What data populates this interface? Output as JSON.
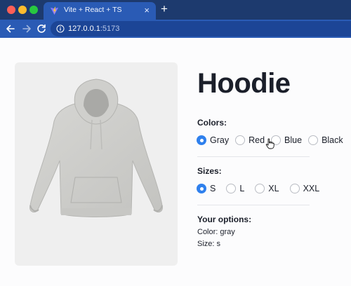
{
  "browser": {
    "tab_title": "Vite + React + TS",
    "tab_close": "×",
    "new_tab": "+",
    "url_host": "127.0.0.1",
    "url_port": ":5173",
    "favicon": "vite-favicon",
    "accent": "#2a5bb5"
  },
  "product": {
    "title": "Hoodie",
    "image": "gray-hoodie"
  },
  "colors": {
    "label": "Colors:",
    "selected": "Gray",
    "options": [
      "Gray",
      "Red",
      "Blue",
      "Black"
    ]
  },
  "sizes": {
    "label": "Sizes:",
    "selected": "S",
    "options": [
      "S",
      "L",
      "XL",
      "XXL"
    ]
  },
  "summary": {
    "label": "Your options:",
    "color_line": "Color: gray",
    "size_line": "Size: s"
  },
  "theme": {
    "radio_checked": "#2f80ed"
  }
}
